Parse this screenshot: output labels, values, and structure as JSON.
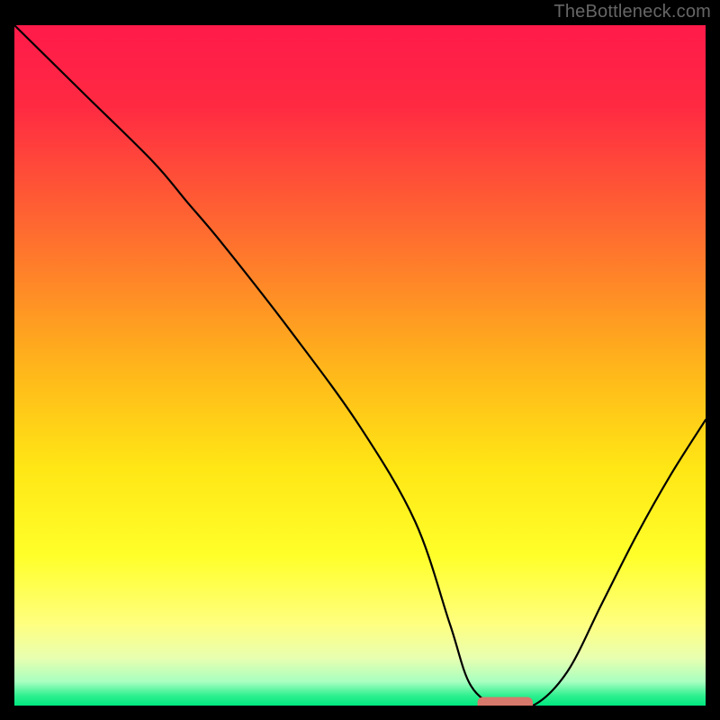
{
  "watermark": "TheBottleneck.com",
  "chart_data": {
    "type": "line",
    "title": "",
    "xlabel": "",
    "ylabel": "",
    "xlim": [
      0,
      100
    ],
    "ylim": [
      0,
      100
    ],
    "grid": false,
    "legend": false,
    "x": [
      0,
      10,
      20,
      25,
      30,
      40,
      50,
      58,
      63,
      66,
      70,
      75,
      80,
      85,
      90,
      95,
      100
    ],
    "values": [
      100,
      90,
      80,
      74,
      68,
      55,
      41,
      27,
      12,
      3,
      0,
      0,
      5,
      15,
      25,
      34,
      42
    ],
    "marker": {
      "x": 71,
      "y": 0,
      "width": 8,
      "height": 2,
      "color": "#d6786b"
    },
    "gradient_stops": [
      {
        "offset": 0.0,
        "color": "#ff1a4a"
      },
      {
        "offset": 0.12,
        "color": "#ff2a42"
      },
      {
        "offset": 0.3,
        "color": "#ff6a30"
      },
      {
        "offset": 0.5,
        "color": "#ffb41b"
      },
      {
        "offset": 0.65,
        "color": "#ffe615"
      },
      {
        "offset": 0.78,
        "color": "#ffff2a"
      },
      {
        "offset": 0.88,
        "color": "#ffff80"
      },
      {
        "offset": 0.93,
        "color": "#e8ffb0"
      },
      {
        "offset": 0.965,
        "color": "#a8ffc0"
      },
      {
        "offset": 0.985,
        "color": "#30f090"
      },
      {
        "offset": 1.0,
        "color": "#00e880"
      }
    ]
  }
}
